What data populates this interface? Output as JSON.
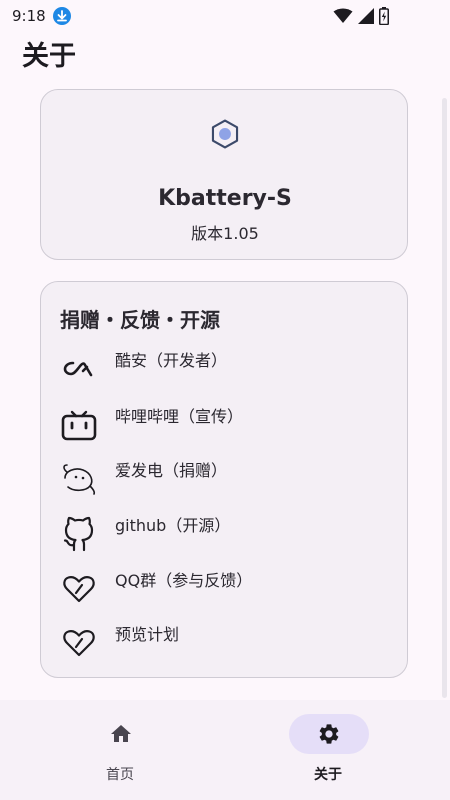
{
  "status_bar": {
    "time": "9:18"
  },
  "page": {
    "title": "关于"
  },
  "app_card": {
    "name": "Kbattery-S",
    "version": "版本1.05"
  },
  "links_card": {
    "title": "捐赠・反馈・开源",
    "items": [
      {
        "label": "酷安（开发者）",
        "icon": "coolapk-icon"
      },
      {
        "label": "哔哩哔哩（宣传）",
        "icon": "bilibili-icon"
      },
      {
        "label": "爱发电（捐赠）",
        "icon": "afdian-icon"
      },
      {
        "label": "github（开源）",
        "icon": "github-icon"
      },
      {
        "label": "QQ群（参与反馈）",
        "icon": "heart-icon"
      },
      {
        "label": "预览计划",
        "icon": "heart-icon"
      }
    ]
  },
  "bottom_nav": {
    "items": [
      {
        "label": "首页",
        "icon": "home-icon",
        "selected": false
      },
      {
        "label": "关于",
        "icon": "settings-icon",
        "selected": true
      }
    ]
  },
  "colors": {
    "accent": "#e5def8",
    "background": "#fdf7fc",
    "card": "#f4eff5",
    "download_badge": "#1e88e5"
  }
}
